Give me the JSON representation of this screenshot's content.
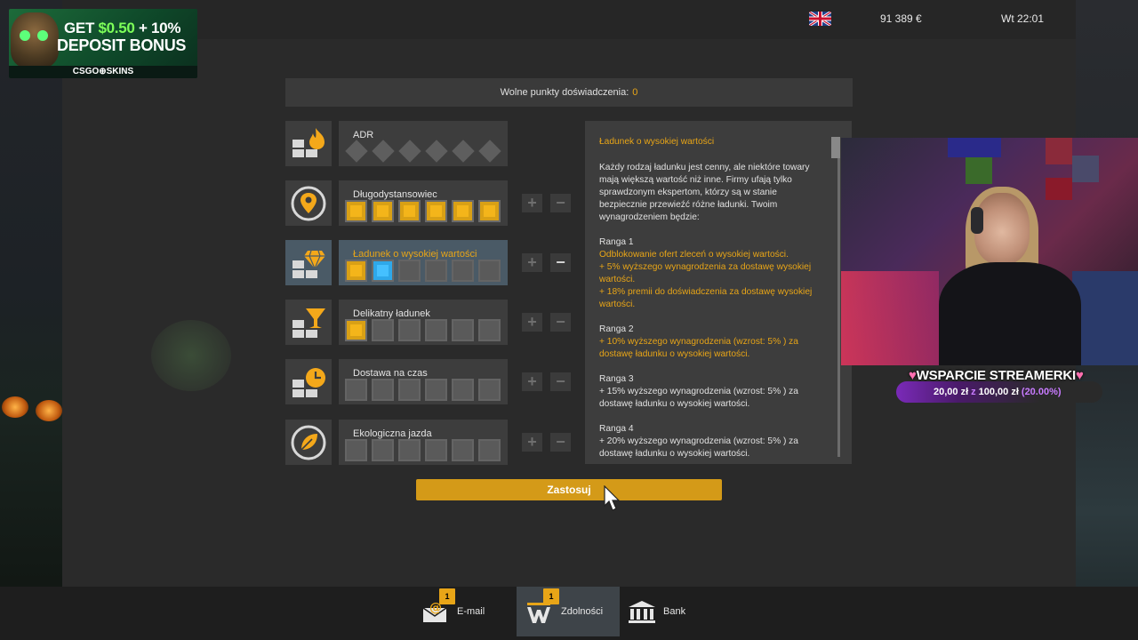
{
  "header": {
    "money": "91 389 €",
    "clock": "Wt 22:01",
    "language_icon": "uk-flag-icon"
  },
  "promo": {
    "line1_prefix": "GET ",
    "line1_amount": "$0.50",
    "line1_suffix": " + 10%",
    "line2": "DEPOSIT BONUS",
    "brand": "CSGO⊕SKINS"
  },
  "xp": {
    "label": "Wolne punkty doświadczenia:",
    "value": "0"
  },
  "skills": [
    {
      "name": "ADR",
      "icon": "fire-icon",
      "level": 0,
      "max": 6,
      "type": "adr"
    },
    {
      "name": "Długodystansowiec",
      "icon": "location-pin-icon",
      "level": 6,
      "max": 6
    },
    {
      "name": "Ładunek o wysokiej wartości",
      "icon": "diamond-icon",
      "level": 2,
      "max": 6,
      "selected": true
    },
    {
      "name": "Delikatny ładunek",
      "icon": "glass-icon",
      "level": 1,
      "max": 6
    },
    {
      "name": "Dostawa na czas",
      "icon": "clock-icon",
      "level": 0,
      "max": 6
    },
    {
      "name": "Ekologiczna jazda",
      "icon": "leaf-icon",
      "level": 0,
      "max": 6
    }
  ],
  "controls": {
    "plus": "+",
    "minus": "−"
  },
  "description": {
    "title": "Ładunek o wysokiej wartości",
    "intro": "Każdy rodzaj ładunku jest cenny, ale niektóre towary mają większą wartość niż inne. Firmy ufają tylko sprawdzonym ekspertom, którzy są w stanie bezpiecznie przewieźć różne ładunki. Twoim wynagrodzeniem będzie:",
    "ranks": [
      {
        "title": "Ranga 1",
        "lines": [
          "Odblokowanie ofert zleceń o wysokiej wartości.",
          "+ 5% wyższego wynagrodzenia za dostawę wysokiej wartości.",
          "+ 18% premii do doświadczenia za dostawę wysokiej wartości."
        ],
        "highlight": true
      },
      {
        "title": "Ranga 2",
        "lines": [
          "+ 10% wyższego wynagrodzenia (wzrost: 5% ) za dostawę ładunku o wysokiej wartości."
        ],
        "highlight": true
      },
      {
        "title": "Ranga 3",
        "lines": [
          "+ 15% wyższego wynagrodzenia (wzrost: 5% ) za dostawę ładunku o wysokiej wartości."
        ],
        "highlight": false
      },
      {
        "title": "Ranga 4",
        "lines": [
          "+ 20% wyższego wynagrodzenia (wzrost: 5% ) za dostawę ładunku o wysokiej wartości."
        ],
        "highlight": false
      }
    ]
  },
  "apply_button": "Zastosuj",
  "nav": [
    {
      "label": "E-mail",
      "icon": "email-icon",
      "badge": "1"
    },
    {
      "label": "Zdolności",
      "icon": "skills-icon",
      "badge": "1",
      "active": true
    },
    {
      "label": "Bank",
      "icon": "bank-icon"
    }
  ],
  "stream_overlay": {
    "support_title": "WSPARCIE STREAMERKI",
    "amount_current": "20,00 zł",
    "amount_sep": "z",
    "amount_goal": "100,00 zł",
    "amount_percent": "(20.00%)"
  },
  "colors": {
    "accent": "#e8a517",
    "selected_slot": "#45c0ff",
    "apply": "#d49a18"
  }
}
